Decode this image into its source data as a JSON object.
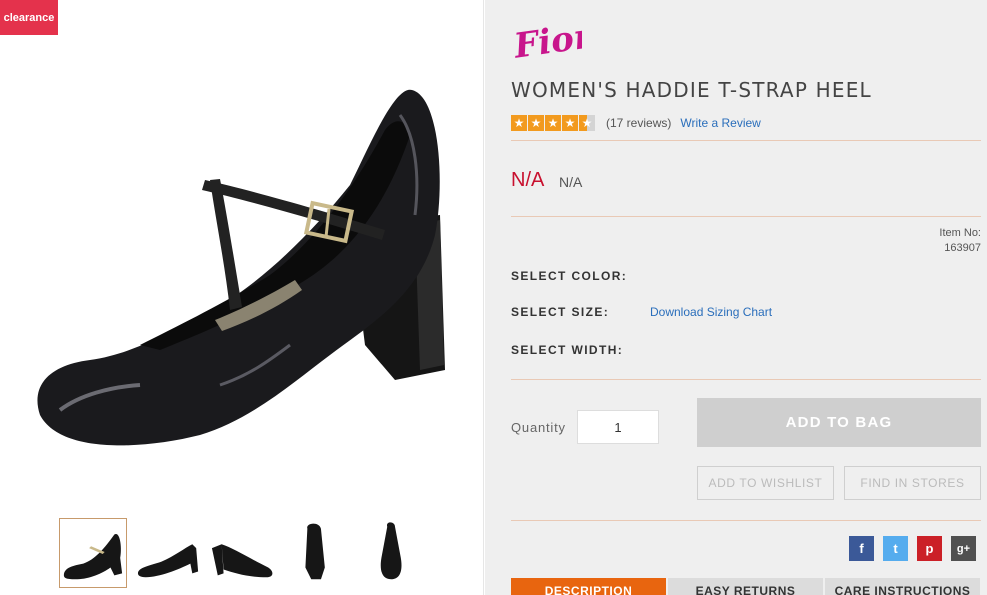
{
  "badge": {
    "label": "clearance"
  },
  "product": {
    "brand": "Fioni",
    "title": "WOMEN'S HADDIE T-STRAP HEEL",
    "rating": {
      "stars": 4.5,
      "reviews_text": "(17 reviews)",
      "write_review": "Write a Review"
    },
    "price": {
      "sale": "N/A",
      "original": "N/A"
    },
    "item_no_label": "Item No:",
    "item_no": "163907"
  },
  "options": {
    "color_label": "SELECT COLOR:",
    "size_label": "SELECT SIZE:",
    "sizing_chart_link": "Download Sizing Chart",
    "width_label": "SELECT WIDTH:"
  },
  "purchase": {
    "quantity_label": "Quantity",
    "quantity_value": "1",
    "add_to_bag": "ADD TO BAG",
    "add_to_wishlist": "ADD TO WISHLIST",
    "find_in_stores": "FIND IN STORES"
  },
  "social": [
    {
      "name": "facebook-icon",
      "glyph": "f"
    },
    {
      "name": "twitter-icon",
      "glyph": "t"
    },
    {
      "name": "pinterest-icon",
      "glyph": "p"
    },
    {
      "name": "google-plus-icon",
      "glyph": "g+"
    }
  ],
  "tabs": [
    "DESCRIPTION",
    "EASY RETURNS",
    "CARE INSTRUCTIONS"
  ],
  "colors": {
    "accent": "#e8650f",
    "price": "#c8102e",
    "link": "#2a6ebb",
    "badge": "#e4324c",
    "brand": "#c8158c"
  }
}
